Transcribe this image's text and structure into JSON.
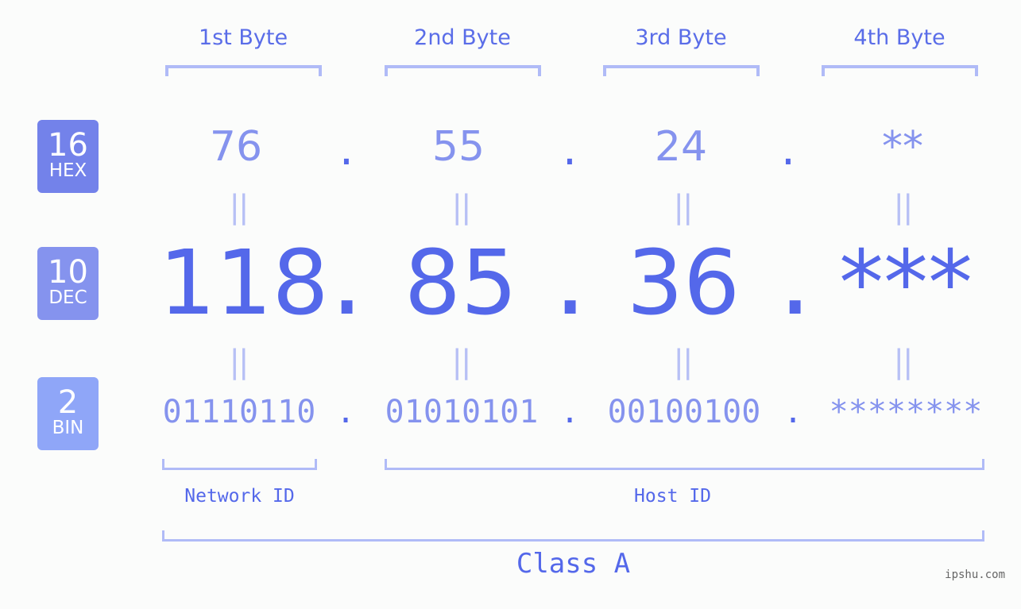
{
  "bytes": [
    {
      "header": "1st Byte",
      "hex": "76",
      "dec": "118",
      "bin": "01110110"
    },
    {
      "header": "2nd Byte",
      "hex": "55",
      "dec": "85",
      "bin": "01010101"
    },
    {
      "header": "3rd Byte",
      "hex": "24",
      "dec": "36",
      "bin": "00100100"
    },
    {
      "header": "4th Byte",
      "hex": "**",
      "dec": "***",
      "bin": "********"
    }
  ],
  "separator": ".",
  "equals": "||",
  "badges": {
    "hex": {
      "number": "16",
      "label": "HEX",
      "color": "#7382ea"
    },
    "dec": {
      "number": "10",
      "label": "DEC",
      "color": "#8593ee"
    },
    "bin": {
      "number": "2",
      "label": "BIN",
      "color": "#8fa6f8"
    }
  },
  "network_id_label": "Network ID",
  "host_id_label": "Host ID",
  "class_label": "Class A",
  "watermark": "ipshu.com",
  "colors": {
    "primary": "#5468ea",
    "secondary": "#8593ee",
    "bracket": "#b0bbf7"
  }
}
